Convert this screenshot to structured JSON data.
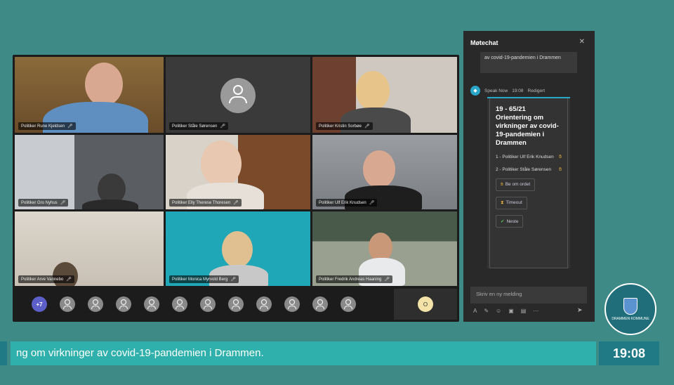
{
  "meeting": {
    "tiles": [
      {
        "name": "Politiker Rune Kjeldsen",
        "bg": "#7b5a34"
      },
      {
        "name": "Politiker Ståle Sørensen",
        "bg": "#3a3a3a",
        "avatar": true
      },
      {
        "name": "Politiker Kristin Sorbøe",
        "bg": "#6a5a4e"
      },
      {
        "name": "Politiker Gro Nyhus",
        "bg": "#555a5e"
      },
      {
        "name": "Politiker Elly Therese Thoresen",
        "bg": "#8a6a4a"
      },
      {
        "name": "Politiker Ulf Erik Knudsen",
        "bg": "#8a8e92"
      },
      {
        "name": "Politiker Arve Vannebo",
        "bg": "#c8c2ba"
      },
      {
        "name": "Politiker Monica Myrvold Berg",
        "bg": "#1fa7b7"
      },
      {
        "name": "Politiker Fredrik Andreas Haaning",
        "bg": "#7a7e74"
      }
    ],
    "extra_count": "+7",
    "self_initial": "O"
  },
  "chat": {
    "title": "Møtechat",
    "prev_message": "av covid-19-pandemien i Drammen",
    "sender": "Speak Now",
    "time": "19:08",
    "edited": "Redigert",
    "card": {
      "title": "19 - 65/21 Orientering om virkninger av covid-19-pandemien i Drammen",
      "speakers": [
        "1 - Politiker Ulf Erik Knudsen",
        "2 - Politiker Ståle Sørensen"
      ],
      "buttons": [
        "Be om ordet",
        "Timeout",
        "Neste"
      ]
    },
    "compose_placeholder": "Skriv en ny melding"
  },
  "logo_text": "DRAMMEN KOMMUNE",
  "ticker": "ng om virkninger av covid-19-pandemien i Drammen.",
  "clock": "19:08"
}
